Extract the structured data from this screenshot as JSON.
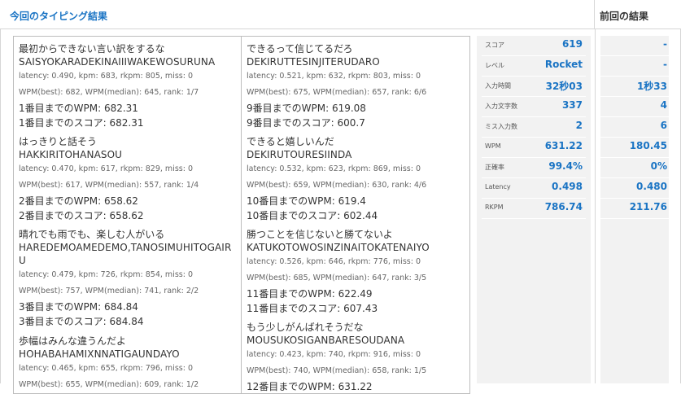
{
  "header": {
    "current_title": "今回のタイピング結果",
    "previous_title": "前回の結果"
  },
  "entries": [
    {
      "jp": "最初からできない言い訳をするな",
      "romaji": "SAISYOKARADEKINAIIIWAKEWOSURUNA",
      "meta1": "latency: 0.490, kpm: 683, rkpm: 805, miss: 0",
      "meta2": "WPM(best): 682, WPM(median): 645, rank: 1/7",
      "wpm": "1番目までのWPM: 682.31",
      "score": "1番目までのスコア: 682.31"
    },
    {
      "jp": "はっきりと話そう",
      "romaji": "HAKKIRITOHANASOU",
      "meta1": "latency: 0.470, kpm: 617, rkpm: 829, miss: 0",
      "meta2": "WPM(best): 617, WPM(median): 557, rank: 1/4",
      "wpm": "2番目までのWPM: 658.62",
      "score": "2番目までのスコア: 658.62"
    },
    {
      "jp": "晴れでも雨でも、楽しむ人がいる",
      "romaji": "HAREDEMOAMEDEMO,TANOSIMUHITOGAIRU",
      "meta1": "latency: 0.479, kpm: 726, rkpm: 854, miss: 0",
      "meta2": "WPM(best): 757, WPM(median): 741, rank: 2/2",
      "wpm": "3番目までのWPM: 684.84",
      "score": "3番目までのスコア: 684.84"
    },
    {
      "jp": "歩幅はみんな違うんだよ",
      "romaji": "HOHABAHAMIXNNATIGAUNDAYO",
      "meta1": "latency: 0.465, kpm: 655, rkpm: 796, miss: 0",
      "meta2": "WPM(best): 655, WPM(median): 609, rank: 1/2",
      "wpm": "",
      "score": ""
    },
    {
      "jp": "できるって信じてるだろ",
      "romaji": "DEKIRUTTESINJITERUDARO",
      "meta1": "latency: 0.521, kpm: 632, rkpm: 803, miss: 0",
      "meta2": "WPM(best): 675, WPM(median): 657, rank: 6/6",
      "wpm": "9番目までのWPM: 619.08",
      "score": "9番目までのスコア: 600.7"
    },
    {
      "jp": "できると嬉しいんだ",
      "romaji": "DEKIRUTOURESIINDA",
      "meta1": "latency: 0.532, kpm: 623, rkpm: 869, miss: 0",
      "meta2": "WPM(best): 659, WPM(median): 630, rank: 4/6",
      "wpm": "10番目までのWPM: 619.4",
      "score": "10番目までのスコア: 602.44"
    },
    {
      "jp": "勝つことを信じないと勝てないよ",
      "romaji": "KATUKOTOWOSINZINAITOKATENAIYO",
      "meta1": "latency: 0.526, kpm: 646, rkpm: 776, miss: 0",
      "meta2": "WPM(best): 685, WPM(median): 647, rank: 3/5",
      "wpm": "11番目までのWPM: 622.49",
      "score": "11番目までのスコア: 607.43"
    },
    {
      "jp": "もう少しがんばれそうだな",
      "romaji": "MOUSUKOSIGANBARESOUDANA",
      "meta1": "latency: 0.423, kpm: 740, rkpm: 916, miss: 0",
      "meta2": "WPM(best): 740, WPM(median): 658, rank: 1/5",
      "wpm": "12番目までのWPM: 631.22",
      "score": ""
    }
  ],
  "stats": [
    {
      "label": "スコア",
      "value": "619",
      "prev": "-"
    },
    {
      "label": "レベル",
      "value": "Rocket",
      "prev": "-"
    },
    {
      "label": "入力時間",
      "value": "32秒03",
      "prev": "1秒33"
    },
    {
      "label": "入力文字数",
      "value": "337",
      "prev": "4"
    },
    {
      "label": "ミス入力数",
      "value": "2",
      "prev": "6"
    },
    {
      "label": "WPM",
      "value": "631.22",
      "prev": "180.45"
    },
    {
      "label": "正確率",
      "value": "99.4%",
      "prev": "0%"
    },
    {
      "label": "Latency",
      "value": "0.498",
      "prev": "0.480"
    },
    {
      "label": "RKPM",
      "value": "786.74",
      "prev": "211.76"
    }
  ]
}
